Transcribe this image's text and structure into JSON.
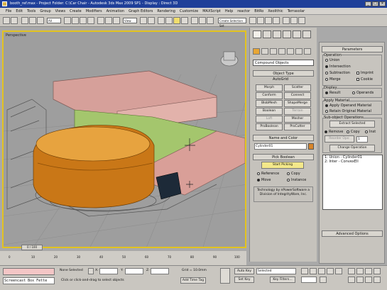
{
  "window": {
    "title": "booth_ref.max - Project Folder: C:\\Car Chair - Autodesk 3ds Max 2009 SP1 - Display : Direct 3D"
  },
  "menu": [
    "File",
    "Edit",
    "Tools",
    "Group",
    "Views",
    "Create",
    "Modifiers",
    "Animation",
    "Graph Editors",
    "Rendering",
    "Customize",
    "MAXScript",
    "Help",
    "reactor",
    "BitRo",
    "Xeolithic",
    "Terrasolar"
  ],
  "toolbar": {
    "filter_value": "All",
    "view_value": "View",
    "selection_set": "Create Selection Set"
  },
  "viewport": {
    "label": "Perspective"
  },
  "command_panel": {
    "category": "Compound Objects",
    "object_type_header": "Object Type",
    "autogrid": "AutoGrid",
    "buttons": [
      [
        "Morph",
        "Scatter"
      ],
      [
        "Conform",
        "Connect"
      ],
      [
        "BlobMesh",
        "ShapeMerge"
      ],
      [
        "Boolean",
        "Terrain"
      ],
      [
        "Loft",
        "Mesher"
      ],
      [
        "ProBoolean",
        "ProCutter"
      ]
    ],
    "name_color_header": "Name and Color",
    "object_name": "Cylinder01",
    "object_color": "#d8862b",
    "pick_boolean_header": "Pick Boolean",
    "start_picking": "Start Picking",
    "pick_options": [
      "Reference",
      "Copy",
      "Move",
      "Instance"
    ],
    "tech_note": "Technology by nPowerSoftware a Division of IntegrityWare, Inc."
  },
  "parameters": {
    "header": "Parameters",
    "operation_label": "Operation",
    "operations": [
      "Union",
      "Intersection",
      "Subtraction",
      "Merge"
    ],
    "op_checks": [
      "Imprint",
      "Cookie"
    ],
    "display_label": "Display",
    "display_options": [
      "Result",
      "Operands"
    ],
    "apply_material_label": "Apply Material",
    "material_options": [
      "Apply Operand Material",
      "Retain Original Material"
    ],
    "subobject_label": "Sub-object Operations",
    "extract_selected": "Extract Selected",
    "extract_options": [
      "Remove",
      "Copy",
      "Inst"
    ],
    "reorder_ops": "Reorder Ops:",
    "reorder_value": "1",
    "change_operation": "Change Operation",
    "ops_list": [
      "1: Union - Cylinder01",
      "2: Inter - ConvexEll"
    ],
    "advanced_options": "Advanced Options"
  },
  "timeline": {
    "frame_slider": "0 / 100",
    "ticks": [
      "0",
      "10",
      "20",
      "30",
      "40",
      "50",
      "60",
      "70",
      "80",
      "90",
      "100"
    ]
  },
  "status": {
    "listener": "Screencast Box Fette",
    "prompt": "Click or click-and-drag to select objects",
    "selected": "None Selected",
    "x_label": "X:",
    "y_label": "Y:",
    "z_label": "Z:",
    "grid": "Grid = 10.0mm",
    "add_time_tag": "Add Time Tag",
    "auto_key": "Auto Key",
    "set_key": "Set Key",
    "key_mode": "Selected",
    "key_filters": "Key Filters..."
  }
}
